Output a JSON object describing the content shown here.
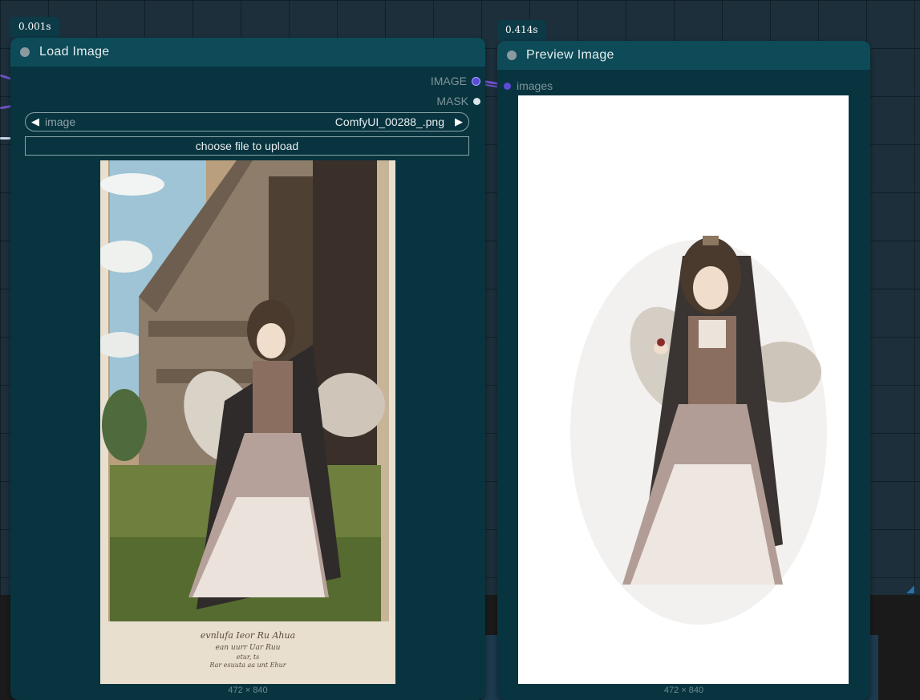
{
  "load_node": {
    "timing": "0.001s",
    "title": "Load Image",
    "outputs": [
      {
        "label": "IMAGE",
        "color": "#5c4bd6"
      },
      {
        "label": "MASK",
        "color": "#d8e4ea"
      }
    ],
    "image_widget": {
      "label": "image",
      "value": "ComfyUI_00288_.png"
    },
    "upload_label": "choose file to upload",
    "image_size": "472 × 840",
    "image_text_lines": [
      "evnlufa Ieor Ru Ahua",
      "ean uurr Uar Ruu",
      "etur, ts",
      "Rar esuuta aa unt Ehur"
    ]
  },
  "preview_node": {
    "timing": "0.414s",
    "title": "Preview Image",
    "input": {
      "label": "images",
      "color": "#5c4bd6"
    },
    "image_size": "472 × 840"
  },
  "colors": {
    "node_body": "#08343f",
    "node_title": "#0d4b58",
    "link": "#6f52c7"
  },
  "icons": {
    "arrow_left": "◀",
    "arrow_right": "▶"
  }
}
